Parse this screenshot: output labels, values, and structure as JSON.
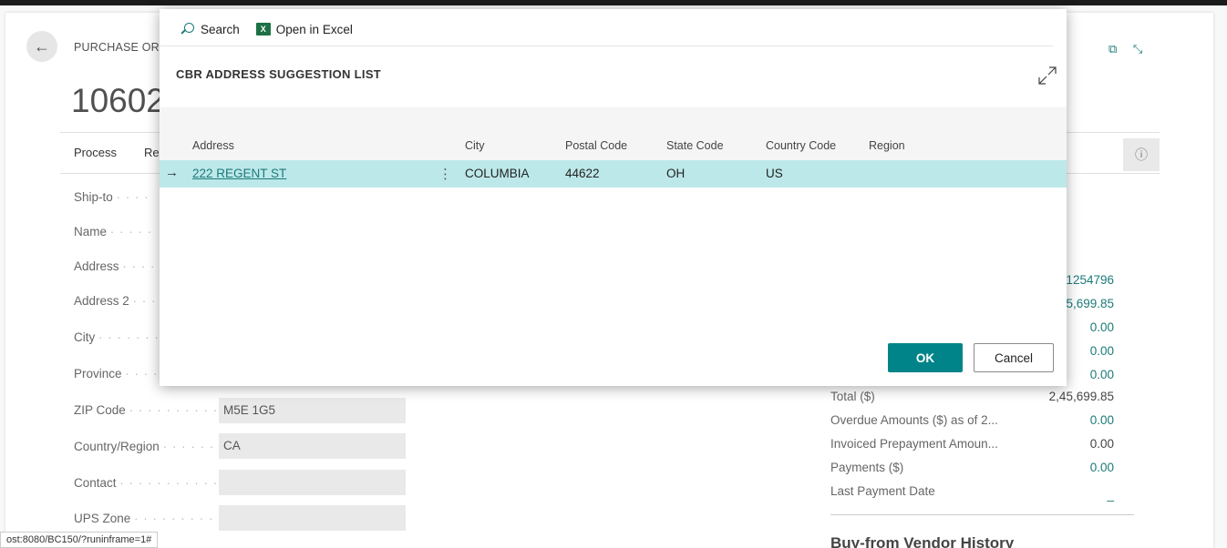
{
  "page": {
    "breadcrumb": "PURCHASE ORD",
    "document_number": "10602",
    "actions": [
      "Process",
      "Rel"
    ],
    "info_icon": "info-icon",
    "window_icons": [
      "open-new-window-icon",
      "collapse-icon"
    ]
  },
  "fields": [
    {
      "label": "Ship-to",
      "value": null
    },
    {
      "label": "Name",
      "value": null
    },
    {
      "label": "Address",
      "value": null
    },
    {
      "label": "Address 2",
      "value": null
    },
    {
      "label": "City",
      "value": null
    },
    {
      "label": "Province",
      "value": null
    },
    {
      "label": "ZIP Code",
      "value": "M5E 1G5"
    },
    {
      "label": "Country/Region",
      "value": "CA"
    },
    {
      "label": "Contact",
      "value": ""
    },
    {
      "label": "UPS Zone",
      "value": ""
    }
  ],
  "factbox": {
    "values_top": [
      "01254796",
      "2,45,699.85",
      "0.00",
      "0.00",
      "0.00"
    ],
    "rows": [
      {
        "label": "Total ($)",
        "value": "2,45,699.85"
      },
      {
        "label": "Overdue Amounts ($) as of 2...",
        "value": "0.00"
      },
      {
        "label": "Invoiced Prepayment Amoun...",
        "value": "0.00"
      },
      {
        "label": "Payments ($)",
        "value": "0.00"
      },
      {
        "label": "Last Payment Date",
        "value": "_"
      }
    ],
    "history_title": "Buy-from Vendor History"
  },
  "status_bar": "ost:8080/BC150/?runinframe=1#",
  "modal": {
    "toolbar": {
      "search_label": "Search",
      "excel_label": "Open in Excel",
      "excel_icon_text": "X"
    },
    "title": "CBR ADDRESS SUGGESTION LIST",
    "columns": [
      "Address",
      "City",
      "Postal Code",
      "State Code",
      "Country Code",
      "Region"
    ],
    "rows": [
      {
        "address": "222 REGENT ST",
        "city": "COLUMBIA",
        "postal_code": "44622",
        "state_code": "OH",
        "country_code": "US",
        "region": "",
        "selected": true
      }
    ],
    "row_indicator": "→",
    "row_menu": "⋮",
    "ok_label": "OK",
    "cancel_label": "Cancel",
    "accent_color": "#008489",
    "selected_row_color": "#bde8ea"
  }
}
